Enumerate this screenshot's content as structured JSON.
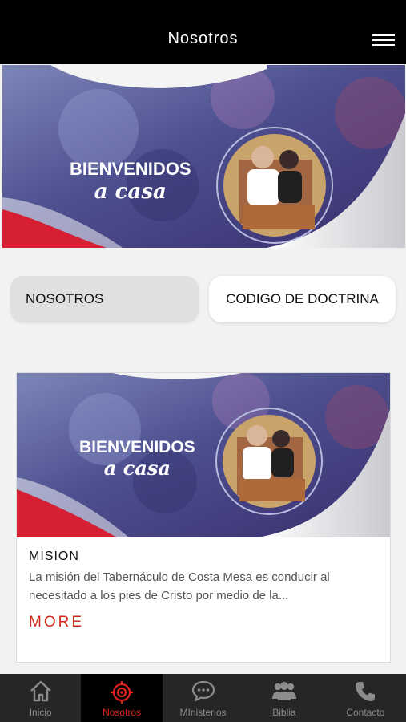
{
  "header": {
    "title": "Nosotros",
    "menu_icon": "hamburger-menu-icon"
  },
  "hero": {
    "line1": "BIENVENIDOS",
    "line2": "a casa"
  },
  "tabs": [
    {
      "label": "NOSOTROS",
      "selected": true
    },
    {
      "label": "CODIGO DE DOCTRINA",
      "selected": false
    }
  ],
  "card": {
    "image": {
      "line1": "BIENVENIDOS",
      "line2": "a casa"
    },
    "title": "MISION",
    "body": "La misión del Tabernáculo de Costa Mesa es conducir al necesitado a los pies de Cristo por medio de la...",
    "more": "MORE"
  },
  "bottom_nav": [
    {
      "label": "Inicio",
      "icon": "home-icon",
      "active": false
    },
    {
      "label": "Nosotros",
      "icon": "target-icon",
      "active": true
    },
    {
      "label": "MInisterios",
      "icon": "chat-bubble-icon",
      "active": false
    },
    {
      "label": "Biblia",
      "icon": "group-icon",
      "active": false
    },
    {
      "label": "Contacto",
      "icon": "phone-icon",
      "active": false
    }
  ],
  "colors": {
    "accent": "#e0231b",
    "more": "#d2291c",
    "topbar": "#000000",
    "bottombar": "#262626"
  }
}
